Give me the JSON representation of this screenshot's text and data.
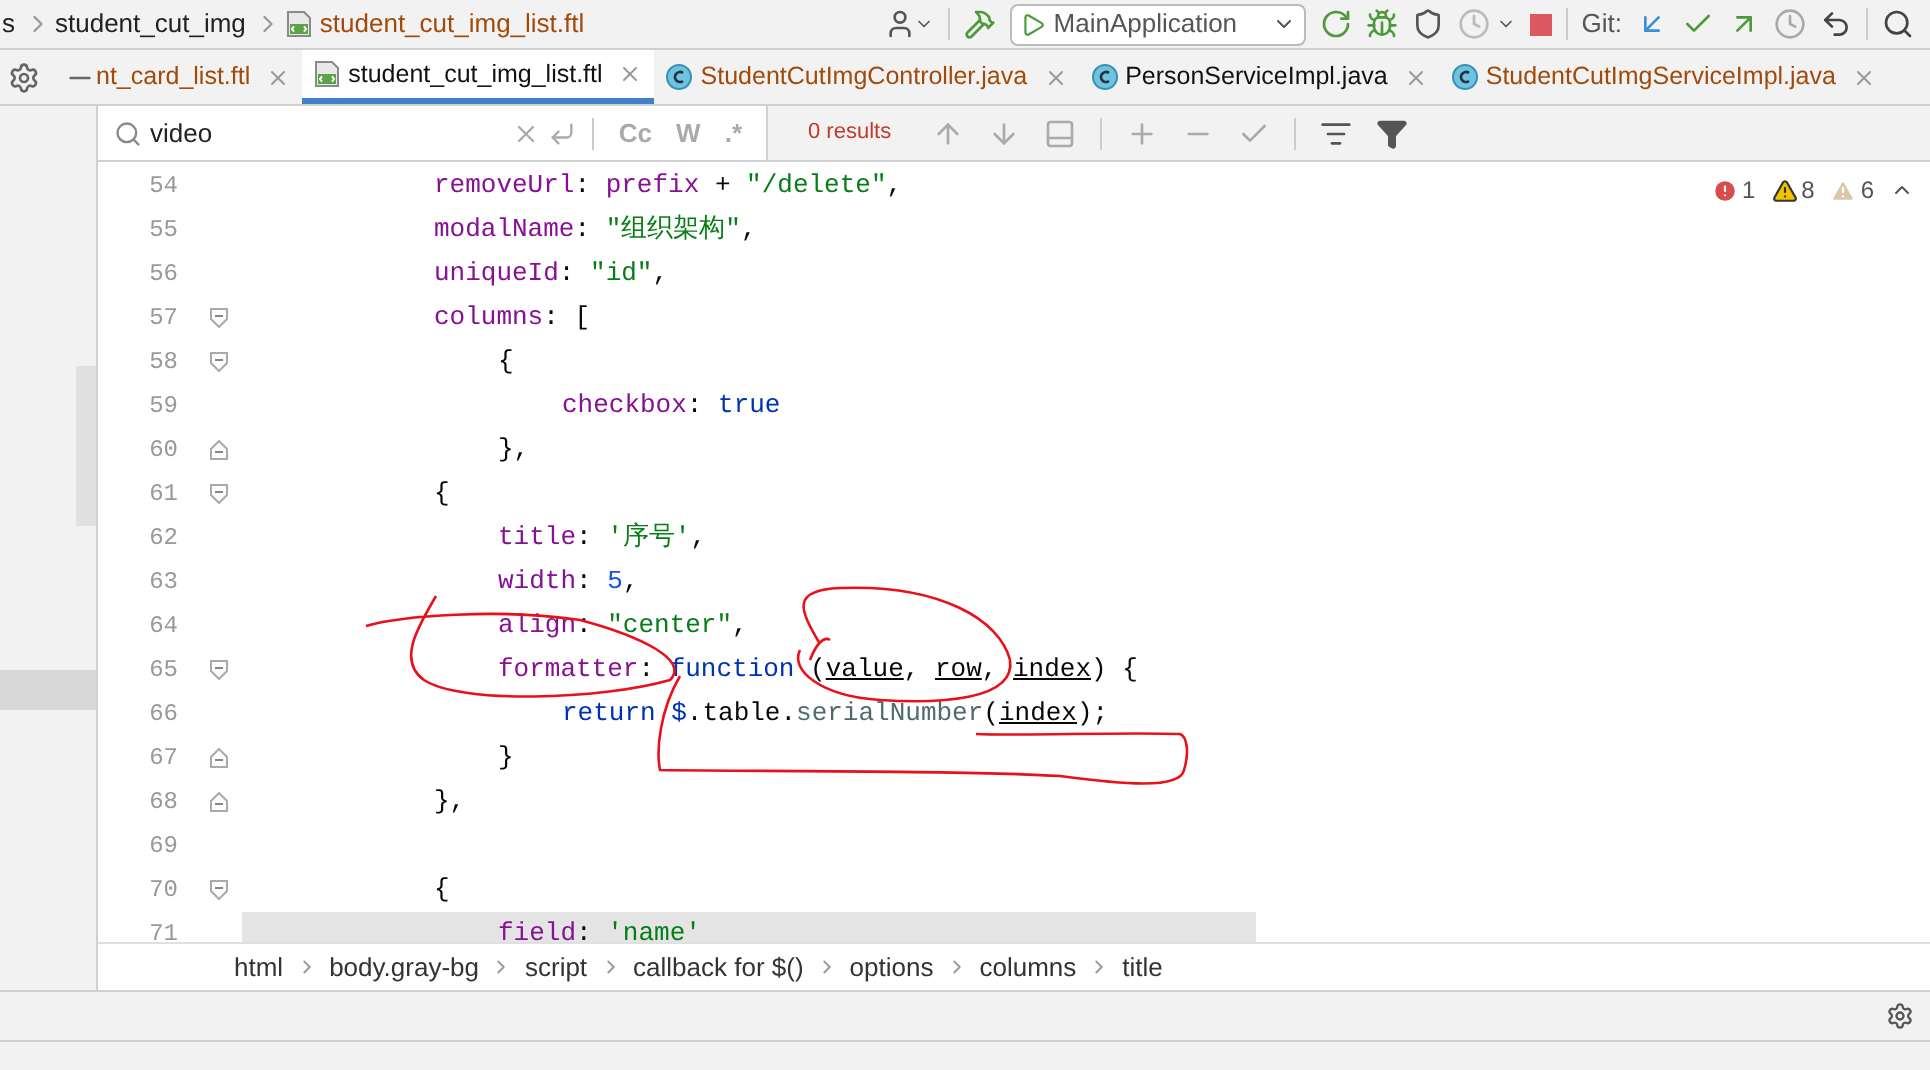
{
  "navbar": {
    "crumbs": [
      {
        "label": "s",
        "kind": "folder"
      },
      {
        "label": "student_cut_img",
        "kind": "folder"
      },
      {
        "label": "student_cut_img_list.ftl",
        "kind": "file"
      }
    ],
    "run_config": "MainApplication",
    "git_label": "Git:"
  },
  "tabs": [
    {
      "label": "nt_card_list.ftl",
      "modified": true,
      "selected": false
    },
    {
      "label": "student_cut_img_list.ftl",
      "kind": "ftl",
      "modified": false,
      "selected": true
    },
    {
      "label": "StudentCutImgController.java",
      "kind": "java",
      "modified": true,
      "selected": false
    },
    {
      "label": "PersonServiceImpl.java",
      "kind": "java",
      "modified": false,
      "selected": false
    },
    {
      "label": "StudentCutImgServiceImpl.java",
      "kind": "java",
      "modified": true,
      "selected": false
    }
  ],
  "search": {
    "value": "video",
    "options": [
      "Cc",
      "W",
      ".*"
    ],
    "results": "0 results"
  },
  "problems": [
    {
      "kind": "error",
      "count": "1"
    },
    {
      "kind": "warning",
      "count": "8"
    },
    {
      "kind": "weak",
      "count": "6"
    }
  ],
  "code": [
    {
      "number": "54",
      "tokens": [
        {
          "text": "removeUrl",
          "kind": "property"
        },
        {
          "text": ":",
          "kind": "plain"
        },
        {
          "text": "prefix",
          "kind": "property",
          "spaced": true
        },
        {
          "text": "+",
          "kind": "plain",
          "spaced": true
        },
        {
          "text": "\"/delete\"",
          "kind": "string",
          "spaced": true
        },
        {
          "text": ",",
          "kind": "plain"
        }
      ]
    },
    {
      "number": "55",
      "tokens": [
        {
          "text": "modalName",
          "kind": "property"
        },
        {
          "text": ":",
          "kind": "plain"
        },
        {
          "text": "\"组织架构\"",
          "kind": "string",
          "spaced": true
        },
        {
          "text": ",",
          "kind": "plain"
        }
      ]
    },
    {
      "number": "56",
      "tokens": [
        {
          "text": "uniqueId",
          "kind": "property"
        },
        {
          "text": ":",
          "kind": "plain"
        },
        {
          "text": "\"id\"",
          "kind": "string",
          "spaced": true
        },
        {
          "text": ",",
          "kind": "plain"
        }
      ]
    },
    {
      "number": "57",
      "fold_start": true,
      "tokens": [
        {
          "text": "columns",
          "kind": "property"
        },
        {
          "text": ":",
          "kind": "plain"
        },
        {
          "text": "[",
          "kind": "plain",
          "spaced": true
        }
      ],
      "children": [
        {
          "number": "58",
          "fold_start": true,
          "tokens": [
            {
              "text": "{",
              "kind": "plain"
            }
          ],
          "children": [
            {
              "number": "59",
              "tokens": [
                {
                  "text": "checkbox",
                  "kind": "property"
                },
                {
                  "text": ":",
                  "kind": "plain"
                },
                {
                  "text": "true",
                  "kind": "keyword",
                  "spaced": true
                }
              ]
            }
          ]
        },
        {
          "number": "60",
          "fold_end": true,
          "tokens": [
            {
              "text": "},",
              "kind": "plain"
            }
          ]
        }
      ]
    },
    {
      "number": "61",
      "fold_start": true,
      "tokens": [
        {
          "text": "{",
          "kind": "plain"
        }
      ],
      "children": [
        {
          "number": "62",
          "tokens": [
            {
              "text": "title",
              "kind": "property"
            },
            {
              "text": ":",
              "kind": "plain"
            },
            {
              "text": "'序号'",
              "kind": "string",
              "spaced": true
            },
            {
              "text": ",",
              "kind": "plain"
            }
          ]
        },
        {
          "number": "63",
          "tokens": [
            {
              "text": "width",
              "kind": "property"
            },
            {
              "text": ":",
              "kind": "plain"
            },
            {
              "text": "5",
              "kind": "number",
              "spaced": true
            },
            {
              "text": ",",
              "kind": "plain"
            }
          ]
        },
        {
          "number": "64",
          "tokens": [
            {
              "text": "align",
              "kind": "property"
            },
            {
              "text": ":",
              "kind": "plain"
            },
            {
              "text": "\"center\"",
              "kind": "string",
              "spaced": true
            },
            {
              "text": ",",
              "kind": "plain"
            }
          ]
        },
        {
          "number": "65",
          "fold_start": true,
          "tokens": [
            {
              "text": "formatter",
              "kind": "property"
            },
            {
              "text": ":",
              "kind": "plain"
            },
            {
              "text": "function",
              "kind": "keyword",
              "spaced": true
            },
            {
              "text": "(",
              "kind": "plain",
              "spaced": true
            },
            {
              "text": "value",
              "kind": "param"
            },
            {
              "text": ",",
              "kind": "plain"
            },
            {
              "text": "row",
              "kind": "param",
              "spaced": true
            },
            {
              "text": ",",
              "kind": "plain"
            },
            {
              "text": "index",
              "kind": "param",
              "spaced": true
            },
            {
              "text": ")",
              "kind": "plain"
            },
            {
              "text": "{",
              "kind": "plain",
              "spaced": true
            }
          ],
          "children": [
            {
              "number": "66",
              "tokens": [
                {
                  "text": "return",
                  "kind": "keyword"
                },
                {
                  "text": "$",
                  "kind": "keyword",
                  "spaced": true
                },
                {
                  "text": ".table.",
                  "kind": "plain"
                },
                {
                  "text": "serialNumber",
                  "kind": "method"
                },
                {
                  "text": "(",
                  "kind": "plain"
                },
                {
                  "text": "index",
                  "kind": "param"
                },
                {
                  "text": ");",
                  "kind": "plain"
                }
              ]
            }
          ]
        },
        {
          "number": "67",
          "fold_end": true,
          "tokens": [
            {
              "text": "}",
              "kind": "plain"
            }
          ]
        }
      ]
    },
    {
      "number": "68",
      "fold_end": true,
      "tokens": [
        {
          "text": "},",
          "kind": "plain"
        }
      ]
    },
    {
      "number": "69"
    },
    {
      "number": "70",
      "fold_start": true,
      "tokens": [
        {
          "text": "{",
          "kind": "plain"
        }
      ],
      "children": [
        {
          "number": "71",
          "current": true,
          "tokens": [
            {
              "text": "field",
              "kind": "property"
            },
            {
              "text": ":",
              "kind": "plain"
            },
            {
              "text": "'name'",
              "kind": "string",
              "spaced": true
            }
          ]
        }
      ]
    }
  ],
  "breadcrumb": [
    "html",
    "body.gray-bg",
    "script",
    "callback for $()",
    "options",
    "columns",
    "title"
  ]
}
